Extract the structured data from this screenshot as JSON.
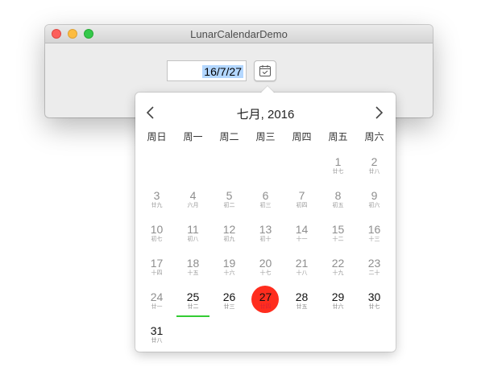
{
  "window": {
    "title": "LunarCalendarDemo"
  },
  "date_field": {
    "value": "16/7/27"
  },
  "icons": {
    "calendar_button": "calendar-icon",
    "prev": "chevron-left-icon",
    "next": "chevron-right-icon"
  },
  "colors": {
    "selected_circle": "#ff2d1e",
    "today_underline": "#33cc33",
    "selection_highlight": "#b3d7ff"
  },
  "calendar": {
    "month_title": "七月, 2016",
    "weekdays": [
      "周日",
      "周一",
      "周二",
      "周三",
      "周四",
      "周五",
      "周六"
    ],
    "today": "25",
    "selected": "27",
    "weeks": [
      [
        null,
        null,
        null,
        null,
        null,
        {
          "solar": "1",
          "lunar": "廿七"
        },
        {
          "solar": "2",
          "lunar": "廿八"
        }
      ],
      [
        {
          "solar": "3",
          "lunar": "廿九"
        },
        {
          "solar": "4",
          "lunar": "六月"
        },
        {
          "solar": "5",
          "lunar": "初二"
        },
        {
          "solar": "6",
          "lunar": "初三"
        },
        {
          "solar": "7",
          "lunar": "初四"
        },
        {
          "solar": "8",
          "lunar": "初五"
        },
        {
          "solar": "9",
          "lunar": "初六"
        }
      ],
      [
        {
          "solar": "10",
          "lunar": "初七"
        },
        {
          "solar": "11",
          "lunar": "初八"
        },
        {
          "solar": "12",
          "lunar": "初九"
        },
        {
          "solar": "13",
          "lunar": "初十"
        },
        {
          "solar": "14",
          "lunar": "十一"
        },
        {
          "solar": "15",
          "lunar": "十二"
        },
        {
          "solar": "16",
          "lunar": "十三"
        }
      ],
      [
        {
          "solar": "17",
          "lunar": "十四"
        },
        {
          "solar": "18",
          "lunar": "十五"
        },
        {
          "solar": "19",
          "lunar": "十六"
        },
        {
          "solar": "20",
          "lunar": "十七"
        },
        {
          "solar": "21",
          "lunar": "十八"
        },
        {
          "solar": "22",
          "lunar": "十九"
        },
        {
          "solar": "23",
          "lunar": "二十"
        }
      ],
      [
        {
          "solar": "24",
          "lunar": "廿一"
        },
        {
          "solar": "25",
          "lunar": "廿二"
        },
        {
          "solar": "26",
          "lunar": "廿三"
        },
        {
          "solar": "27",
          "lunar": "廿四"
        },
        {
          "solar": "28",
          "lunar": "廿五"
        },
        {
          "solar": "29",
          "lunar": "廿六"
        },
        {
          "solar": "30",
          "lunar": "廿七"
        }
      ],
      [
        {
          "solar": "31",
          "lunar": "廿八"
        },
        null,
        null,
        null,
        null,
        null,
        null
      ]
    ]
  }
}
